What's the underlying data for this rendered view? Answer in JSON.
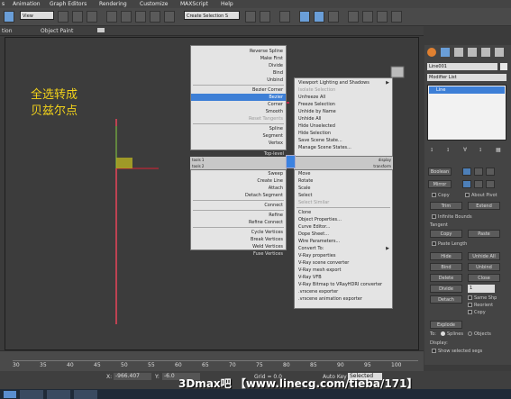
{
  "menu": {
    "items": [
      "s",
      "Animation",
      "Graph Editors",
      "Rendering",
      "Customize",
      "MAXScript",
      "Help"
    ]
  },
  "toolbar": {
    "selection_filter": "View",
    "named_selection": "Create Selection S"
  },
  "ribbon": {
    "left_label": "tion",
    "object_paint": "Object Paint"
  },
  "viewport": {
    "annotation_line1": "全选转成",
    "annotation_line2": "贝兹尔点"
  },
  "quad_left": {
    "items": [
      {
        "label": "Reverse Spline",
        "state": "normal"
      },
      {
        "label": "Make First",
        "state": "normal"
      },
      {
        "label": "Divide",
        "state": "normal"
      },
      {
        "label": "Bind",
        "state": "normal"
      },
      {
        "label": "Unbind",
        "state": "normal"
      },
      {
        "label": "Bezier Corner",
        "state": "normal"
      },
      {
        "label": "Bezier",
        "state": "highlighted"
      },
      {
        "label": "Corner",
        "state": "normal"
      },
      {
        "label": "Smooth",
        "state": "normal"
      },
      {
        "label": "Reset Tangents",
        "state": "dim"
      },
      {
        "label": "Spline",
        "state": "normal"
      },
      {
        "label": "Segment",
        "state": "normal"
      },
      {
        "label": "Vertex",
        "state": "checked"
      },
      {
        "label": "Top-level",
        "state": "normal"
      }
    ],
    "header_tools1": "tools 1",
    "header_tools2": "tools 2",
    "lower": [
      "Sweep",
      "Create Line",
      "Attach",
      "Detach Segment",
      "Connect",
      "Refine",
      "Refine Connect",
      "Cycle Vertices",
      "Break Vertices",
      "Weld Vertices",
      "Fuse Vertices"
    ]
  },
  "quad_right": {
    "items": [
      {
        "label": "Viewport Lighting and Shadows",
        "state": "submenu"
      },
      {
        "label": "Isolate Selection",
        "state": "dim"
      },
      {
        "label": "Unfreeze All",
        "state": "normal"
      },
      {
        "label": "Freeze Selection",
        "state": "normal"
      },
      {
        "label": "Unhide by Name",
        "state": "normal"
      },
      {
        "label": "Unhide All",
        "state": "normal"
      },
      {
        "label": "Hide Unselected",
        "state": "normal"
      },
      {
        "label": "Hide Selection",
        "state": "normal"
      },
      {
        "label": "Save Scene State...",
        "state": "normal"
      },
      {
        "label": "Manage Scene States...",
        "state": "normal"
      }
    ],
    "header_display": "display",
    "header_transform": "transform",
    "lower": [
      "Move",
      "Rotate",
      "Scale",
      "Select",
      "Select Similar",
      "Clone",
      "Object Properties...",
      "Curve Editor...",
      "Dope Sheet...",
      "Wire Parameters...",
      "Convert To:",
      "V-Ray properties",
      "V-Ray scene converter",
      "V-Ray mesh export",
      "V-Ray VFB",
      "V-Ray Bitmap to VRayHDRI converter",
      ".vrscene exporter",
      ".vrscene animation exporter"
    ]
  },
  "command_panel": {
    "object_name": "Line001",
    "modifier_list": "Modifier List",
    "stack_item": "Line",
    "buttons": {
      "boolean": "Boolean",
      "mirror": "Mirror",
      "copy": "Copy",
      "about_pivot": "About Pivot",
      "trim": "Trim",
      "extend": "Extend",
      "infinite_bounds": "Infinite Bounds",
      "tangent": "Tangent",
      "tan_copy": "Copy",
      "tan_paste": "Paste",
      "paste_length": "Paste Length",
      "hide": "Hide",
      "unhide_all": "Unhide All",
      "bind": "Bind",
      "unbind": "Unbind",
      "delete": "Delete",
      "close": "Close",
      "divide": "Divide",
      "divide_value": "1",
      "detach": "Detach",
      "same_shp": "Same Shp",
      "reorient": "Reorient",
      "copy2": "Copy",
      "explode": "Explode",
      "to": "To:",
      "splines": "Splines",
      "objects": "Objects",
      "display": "Display:",
      "show_selected_segs": "Show selected segs"
    }
  },
  "timeline": {
    "ticks": [
      "30",
      "35",
      "40",
      "45",
      "50",
      "55",
      "60",
      "65",
      "70",
      "75",
      "80",
      "85",
      "90",
      "95",
      "100"
    ]
  },
  "status": {
    "x_label": "X:",
    "x_value": "-966.407",
    "y_label": "Y:",
    "y_value": "-6.0",
    "grid": "Grid = 0.0",
    "autokey": "Auto Key",
    "selected": "Selected"
  },
  "watermark": "3Dmax吧 【www.linecg.com/tieba/171】"
}
